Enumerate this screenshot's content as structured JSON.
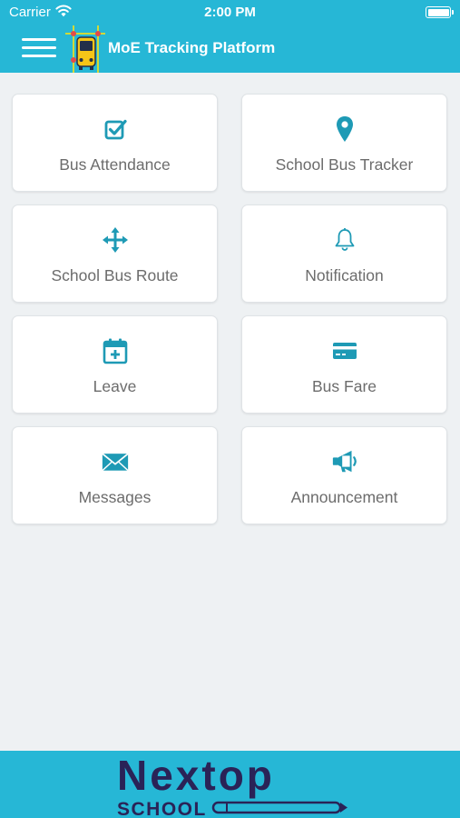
{
  "status_bar": {
    "carrier": "Carrier",
    "time": "2:00 PM",
    "wifi_icon": "wifi-icon",
    "battery_icon": "battery-full-icon"
  },
  "header": {
    "menu_icon": "hamburger-menu-icon",
    "logo_icon": "school-bus-tracking-logo",
    "title": "MoE Tracking Platform",
    "background_color": "#26b7d6"
  },
  "tiles": [
    {
      "label": "Bus Attendance",
      "icon": "checkbox-check-icon"
    },
    {
      "label": "School Bus Tracker",
      "icon": "map-pin-icon"
    },
    {
      "label": "School Bus Route",
      "icon": "move-arrows-icon"
    },
    {
      "label": "Notification",
      "icon": "bell-icon"
    },
    {
      "label": "Leave",
      "icon": "calendar-plus-icon"
    },
    {
      "label": "Bus Fare",
      "icon": "credit-card-icon"
    },
    {
      "label": "Messages",
      "icon": "envelope-icon"
    },
    {
      "label": "Announcement",
      "icon": "megaphone-icon"
    }
  ],
  "footer": {
    "brand_name": "Nextop",
    "brand_subtitle": "SCHOOL",
    "brand_name_color": "#2a2357",
    "brand_accent_color": "#e34a4a"
  },
  "colors": {
    "accent": "#26b7d6",
    "icon": "#1e9ab5",
    "page_background": "#eef1f3"
  }
}
